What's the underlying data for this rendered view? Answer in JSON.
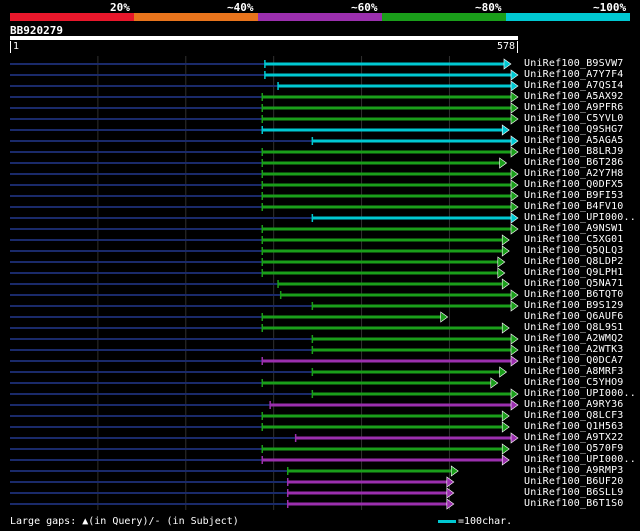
{
  "legend": {
    "labels": [
      "20%",
      "~40%",
      "~60%",
      "~80%",
      "~100%"
    ],
    "colors": [
      "#e8172b",
      "#e8741c",
      "#9b2fae",
      "#1a9e1a",
      "#00c8d2"
    ]
  },
  "query": {
    "id": "BB920279",
    "start_label": "1",
    "end_label": "578",
    "length": 578
  },
  "footer": {
    "gaps_text": "Large gaps: ▲(in Query)/- (in Subject)",
    "scale_text": "=100char."
  },
  "hits": [
    {
      "name": "UniRef100_B9SVW7",
      "start": 290,
      "end": 570,
      "color": "#00c8d2"
    },
    {
      "name": "UniRef100_A7Y7F4",
      "start": 290,
      "end": 578,
      "color": "#00c8d2"
    },
    {
      "name": "UniRef100_A7QSI4",
      "start": 305,
      "end": 578,
      "color": "#00c8d2"
    },
    {
      "name": "UniRef100_A5AX92",
      "start": 287,
      "end": 578,
      "color": "#1a9e1a"
    },
    {
      "name": "UniRef100_A9PFR6",
      "start": 287,
      "end": 578,
      "color": "#1a9e1a"
    },
    {
      "name": "UniRef100_C5YVL0",
      "start": 287,
      "end": 578,
      "color": "#1a9e1a"
    },
    {
      "name": "UniRef100_Q9SHG7",
      "start": 287,
      "end": 568,
      "color": "#00c8d2"
    },
    {
      "name": "UniRef100_A5AGA5",
      "start": 344,
      "end": 578,
      "color": "#00c8d2"
    },
    {
      "name": "UniRef100_B8LRJ9",
      "start": 287,
      "end": 578,
      "color": "#1a9e1a"
    },
    {
      "name": "UniRef100_B6T286",
      "start": 287,
      "end": 565,
      "color": "#1a9e1a"
    },
    {
      "name": "UniRef100_A2Y7H8",
      "start": 287,
      "end": 578,
      "color": "#1a9e1a"
    },
    {
      "name": "UniRef100_Q0DFX5",
      "start": 287,
      "end": 578,
      "color": "#1a9e1a"
    },
    {
      "name": "UniRef100_B9FI53",
      "start": 287,
      "end": 578,
      "color": "#1a9e1a"
    },
    {
      "name": "UniRef100_B4FV10",
      "start": 287,
      "end": 578,
      "color": "#1a9e1a"
    },
    {
      "name": "UniRef100_UPI000..",
      "start": 344,
      "end": 578,
      "color": "#00c8d2"
    },
    {
      "name": "UniRef100_A9NSW1",
      "start": 287,
      "end": 578,
      "color": "#1a9e1a"
    },
    {
      "name": "UniRef100_C5XG01",
      "start": 287,
      "end": 568,
      "color": "#1a9e1a"
    },
    {
      "name": "UniRef100_Q5QLQ3",
      "start": 287,
      "end": 568,
      "color": "#1a9e1a"
    },
    {
      "name": "UniRef100_Q8LDP2",
      "start": 287,
      "end": 563,
      "color": "#1a9e1a"
    },
    {
      "name": "UniRef100_Q9LPH1",
      "start": 287,
      "end": 563,
      "color": "#1a9e1a"
    },
    {
      "name": "UniRef100_Q5NA71",
      "start": 305,
      "end": 568,
      "color": "#1a9e1a"
    },
    {
      "name": "UniRef100_B6TQT0",
      "start": 308,
      "end": 578,
      "color": "#1a9e1a"
    },
    {
      "name": "UniRef100_B9S129",
      "start": 344,
      "end": 578,
      "color": "#1a9e1a"
    },
    {
      "name": "UniRef100_Q6AUF6",
      "start": 287,
      "end": 498,
      "color": "#1a9e1a"
    },
    {
      "name": "UniRef100_Q8L9S1",
      "start": 287,
      "end": 568,
      "color": "#1a9e1a"
    },
    {
      "name": "UniRef100_A2WMQ2",
      "start": 344,
      "end": 578,
      "color": "#1a9e1a"
    },
    {
      "name": "UniRef100_A2WTK3",
      "start": 344,
      "end": 578,
      "color": "#1a9e1a"
    },
    {
      "name": "UniRef100_Q0DCA7",
      "start": 287,
      "end": 578,
      "color": "#9b2fae"
    },
    {
      "name": "UniRef100_A8MRF3",
      "start": 344,
      "end": 565,
      "color": "#1a9e1a"
    },
    {
      "name": "UniRef100_C5YHO9",
      "start": 287,
      "end": 555,
      "color": "#1a9e1a"
    },
    {
      "name": "UniRef100_UPI000..",
      "start": 344,
      "end": 578,
      "color": "#1a9e1a"
    },
    {
      "name": "UniRef100_A9RY36",
      "start": 296,
      "end": 578,
      "color": "#9b2fae"
    },
    {
      "name": "UniRef100_Q8LCF3",
      "start": 287,
      "end": 568,
      "color": "#1a9e1a"
    },
    {
      "name": "UniRef100_Q1H563",
      "start": 287,
      "end": 568,
      "color": "#1a9e1a"
    },
    {
      "name": "UniRef100_A9TX22",
      "start": 325,
      "end": 578,
      "color": "#9b2fae"
    },
    {
      "name": "UniRef100_Q570F9",
      "start": 287,
      "end": 568,
      "color": "#1a9e1a"
    },
    {
      "name": "UniRef100_UPI000..",
      "start": 287,
      "end": 568,
      "color": "#9b2fae"
    },
    {
      "name": "UniRef100_A9RMP3",
      "start": 316,
      "end": 510,
      "color": "#1a9e1a"
    },
    {
      "name": "UniRef100_B6UF20",
      "start": 316,
      "end": 505,
      "color": "#9b2fae"
    },
    {
      "name": "UniRef100_B6SLL9",
      "start": 316,
      "end": 505,
      "color": "#9b2fae"
    },
    {
      "name": "UniRef100_B6T1S0",
      "start": 316,
      "end": 505,
      "color": "#9b2fae"
    }
  ]
}
